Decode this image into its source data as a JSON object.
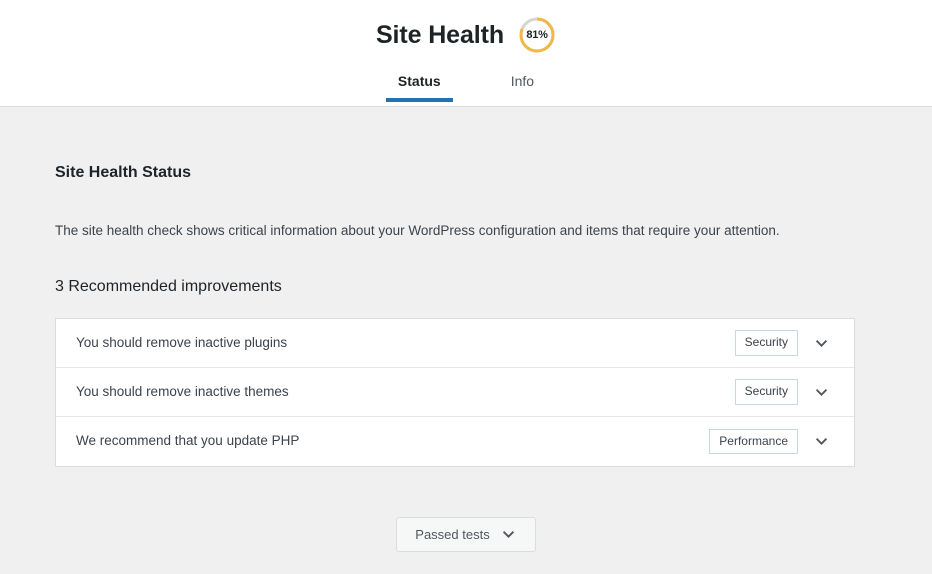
{
  "header": {
    "title": "Site Health",
    "score": {
      "value": 81,
      "label": "81%",
      "arc_color": "#f0b849",
      "track_color": "#d5d5d5"
    },
    "tabs": [
      {
        "label": "Status",
        "active": true
      },
      {
        "label": "Info",
        "active": false
      }
    ],
    "active_tab_color": "#2271b1"
  },
  "main": {
    "section_heading": "Site Health Status",
    "description": "The site health check shows critical information about your WordPress configuration and items that require your attention.",
    "improvements_heading": "3 Recommended improvements",
    "issues": [
      {
        "title": "You should remove inactive plugins",
        "badge": "Security",
        "icon": "chevron-down-icon"
      },
      {
        "title": "You should remove inactive themes",
        "badge": "Security",
        "icon": "chevron-down-icon"
      },
      {
        "title": "We recommend that you update PHP",
        "badge": "Performance",
        "icon": "chevron-down-icon"
      }
    ]
  },
  "footer": {
    "passed_tests_label": "Passed tests",
    "passed_tests_icon": "chevron-down-icon"
  }
}
